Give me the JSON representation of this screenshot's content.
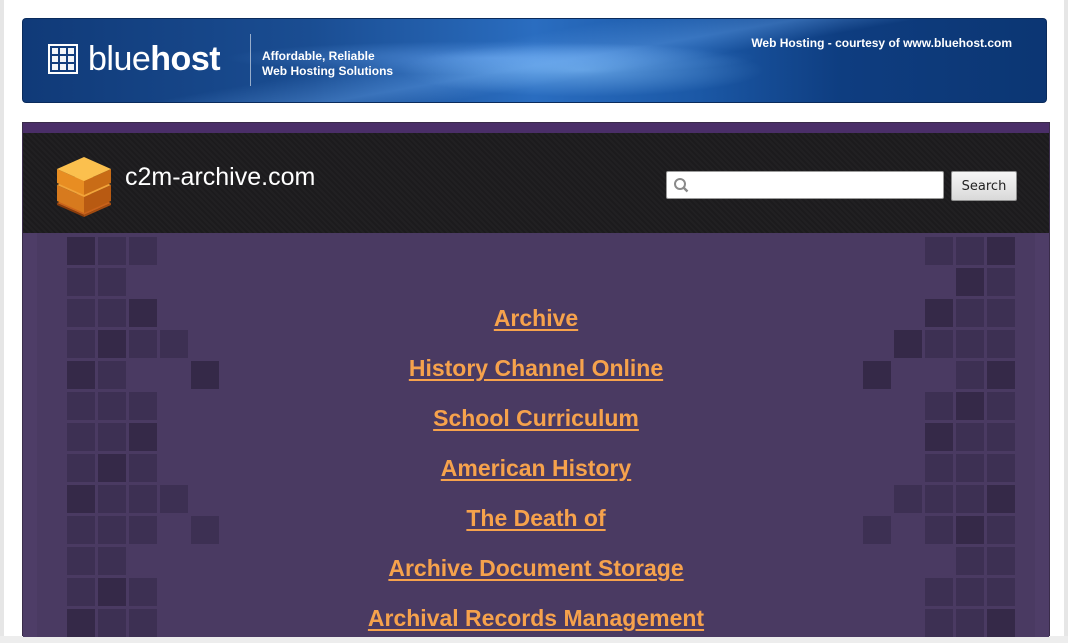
{
  "banner": {
    "brand_light": "blue",
    "brand_bold": "host",
    "tagline_line1": "Affordable, Reliable",
    "tagline_line2": "Web Hosting Solutions",
    "courtesy": "Web Hosting - courtesy of www.bluehost.com",
    "colors": {
      "background": "#1a4d92",
      "text": "#ffffff"
    }
  },
  "site": {
    "name": "c2m-archive.com",
    "logo_icon": "stacked-cube-icon",
    "search": {
      "placeholder": "",
      "value": "",
      "button_label": "Search",
      "icon": "magnifier-icon"
    },
    "colors": {
      "header": "#1c1b1d",
      "content": "#4a3a62",
      "accent_strip": "#4a2e68",
      "link": "#f6a24c"
    }
  },
  "links": [
    "Archive",
    "History Channel Online",
    "School Curriculum",
    "American History",
    "The Death of",
    "Archive Document Storage",
    "Archival Records Management"
  ]
}
